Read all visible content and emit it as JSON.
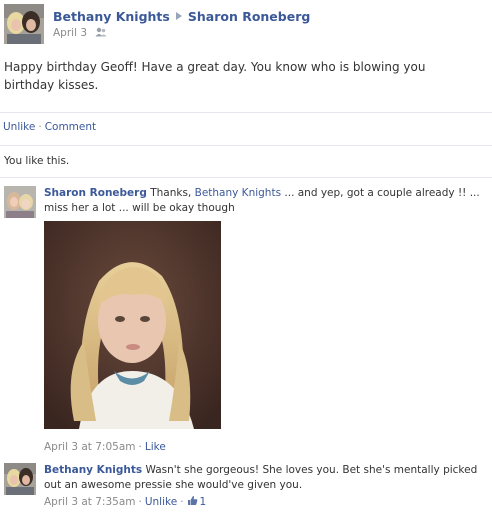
{
  "post": {
    "author": "Bethany Knights",
    "target": "Sharon Roneberg",
    "date": "April 3",
    "privacy_icon": "friends-icon",
    "body": "Happy birthday Geoff! Have a great day. You know who is blowing you birthday kisses."
  },
  "actions": {
    "unlike": "Unlike",
    "separator": "·",
    "comment": "Comment"
  },
  "likes_text": "You like this.",
  "comments": [
    {
      "author": "Sharon Roneberg",
      "text_before": "Thanks, ",
      "mention": "Bethany Knights",
      "text_after": " ... and yep, got a couple already !! ... miss her a lot ... will be okay though",
      "time": "April 3 at 7:05am",
      "separator": "·",
      "like": "Like"
    },
    {
      "author": "Bethany Knights",
      "text": "Wasn't she gorgeous! She loves you. Bet she's mentally picked out an awesome pressie she would've given you.",
      "time": "April 3 at 7:35am",
      "separator": "·",
      "unlike": "Unlike",
      "separator2": "·",
      "like_count": "1",
      "like_icon": "thumbs-up-icon"
    }
  ],
  "colors": {
    "link": "#3b5998",
    "text": "#333333",
    "muted": "#8a8a8a",
    "divider": "#e3e6ec"
  }
}
